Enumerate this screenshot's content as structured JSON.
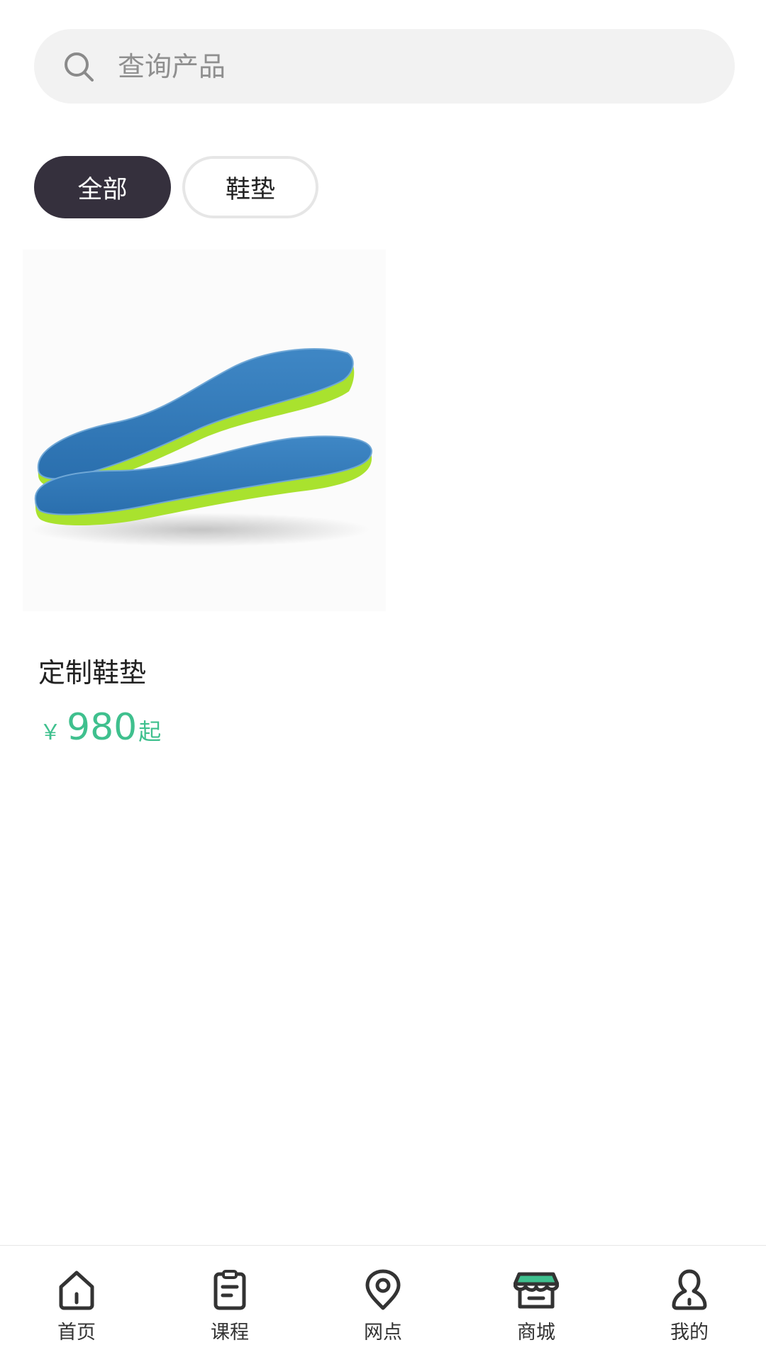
{
  "search": {
    "placeholder": "查询产品",
    "icon": "search-icon"
  },
  "filters": [
    {
      "label": "全部",
      "active": true
    },
    {
      "label": "鞋垫",
      "active": false
    }
  ],
  "products": [
    {
      "name": "定制鞋垫",
      "price_symbol": "￥",
      "price_amount": "980",
      "price_suffix": "起",
      "image": "insole-product-image"
    }
  ],
  "tabbar": {
    "items": [
      {
        "label": "首页",
        "icon": "home-icon"
      },
      {
        "label": "课程",
        "icon": "clipboard-icon"
      },
      {
        "label": "网点",
        "icon": "location-pin-icon"
      },
      {
        "label": "商城",
        "icon": "store-icon",
        "active": true
      },
      {
        "label": "我的",
        "icon": "user-icon"
      }
    ]
  },
  "colors": {
    "accent": "#3fc08e",
    "chip_active_bg": "#35303d",
    "search_bg": "#f2f2f2"
  }
}
